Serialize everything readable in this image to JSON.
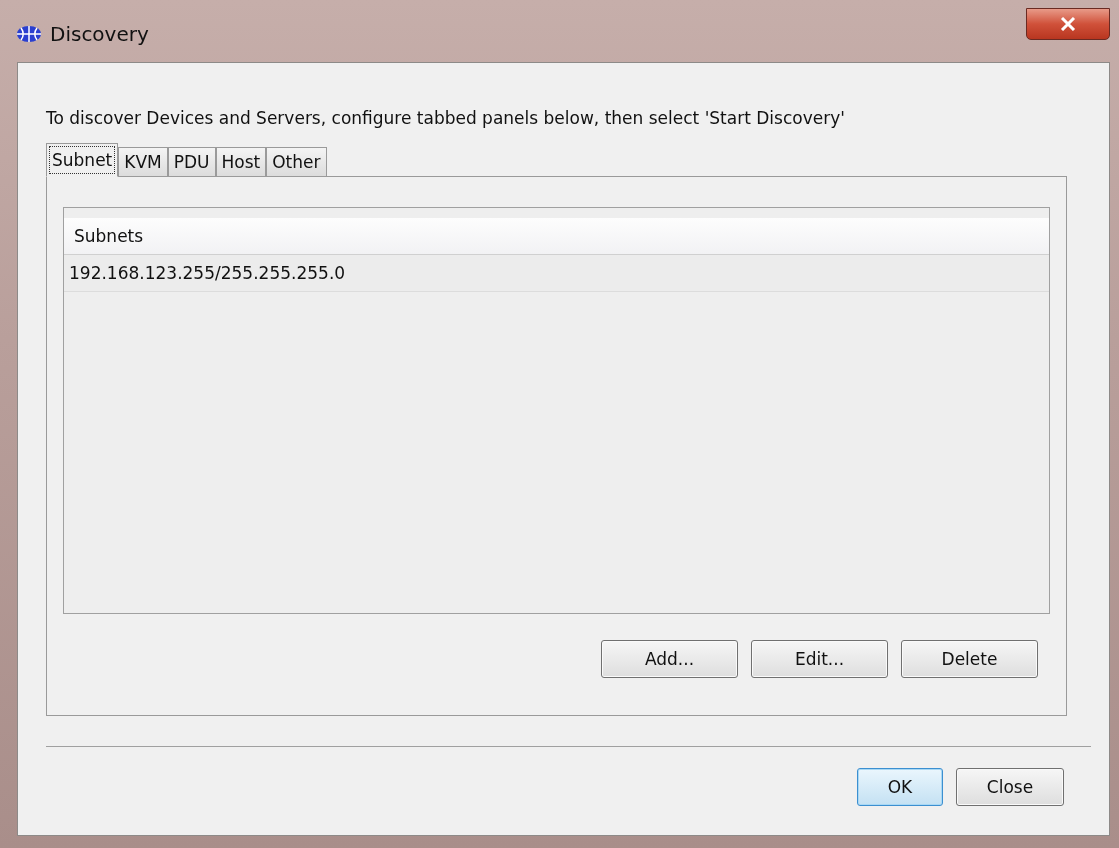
{
  "window": {
    "title": "Discovery"
  },
  "instruction": "To discover Devices and Servers, configure tabbed panels below, then select 'Start Discovery'",
  "tabs": [
    {
      "label": "Subnet",
      "selected": true
    },
    {
      "label": "KVM",
      "selected": false
    },
    {
      "label": "PDU",
      "selected": false
    },
    {
      "label": "Host",
      "selected": false
    },
    {
      "label": "Other",
      "selected": false
    }
  ],
  "table": {
    "columns": [
      "Subnets"
    ],
    "rows": [
      [
        "192.168.123.255/255.255.255.0"
      ]
    ]
  },
  "panel_buttons": [
    "Add...",
    "Edit...",
    "Delete"
  ],
  "dialog_buttons": [
    {
      "label": "OK",
      "default": true
    },
    {
      "label": "Close",
      "default": false
    }
  ]
}
